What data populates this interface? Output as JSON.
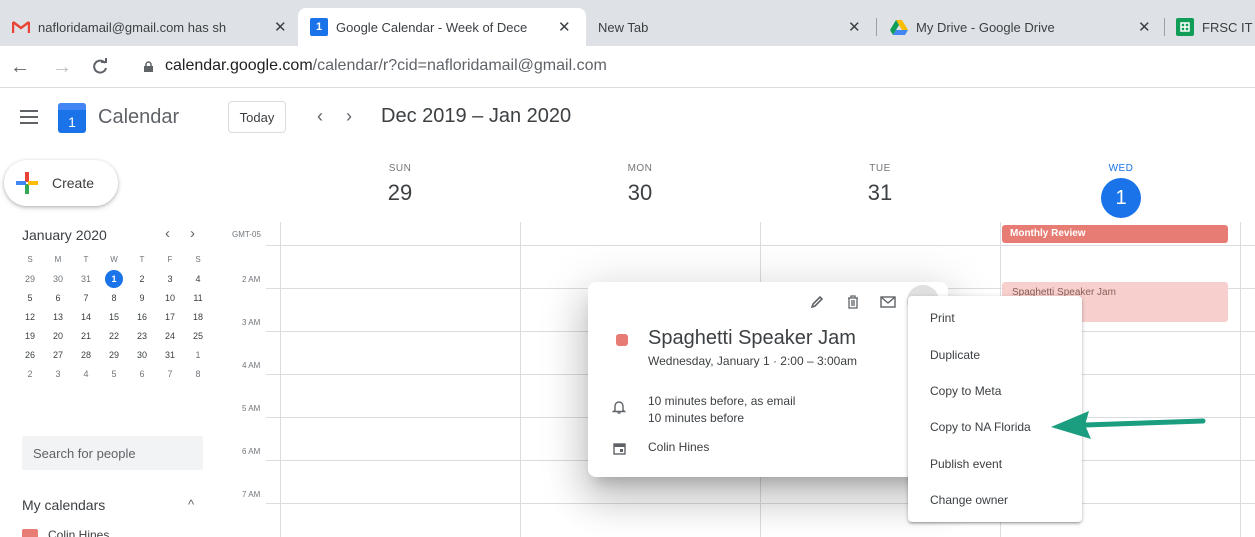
{
  "browser": {
    "tabs": [
      {
        "title": "nafloridamail@gmail.com has sh",
        "favicon": "gmail-icon"
      },
      {
        "title": "Google Calendar - Week of Dece",
        "favicon": "google-calendar-icon",
        "active": true
      },
      {
        "title": "New Tab",
        "favicon": ""
      },
      {
        "title": "My Drive - Google Drive",
        "favicon": "google-drive-icon"
      },
      {
        "title": "FRSC IT",
        "favicon": "google-sheets-icon"
      }
    ],
    "close_glyph": "✕",
    "url_host": "calendar.google.com",
    "url_path": "/calendar/r?cid=nafloridamail@gmail.com"
  },
  "header": {
    "app_title": "Calendar",
    "logo_day": "1",
    "today_label": "Today",
    "prev_glyph": "‹",
    "next_glyph": "›",
    "date_range": "Dec 2019 – Jan 2020"
  },
  "sidebar": {
    "create_label": "Create",
    "mini_calendar": {
      "title": "January 2020",
      "prev_glyph": "‹",
      "next_glyph": "›",
      "weekday_heads": [
        "S",
        "M",
        "T",
        "W",
        "T",
        "F",
        "S"
      ],
      "weeks": [
        [
          "29",
          "30",
          "31",
          "1",
          "2",
          "3",
          "4"
        ],
        [
          "5",
          "6",
          "7",
          "8",
          "9",
          "10",
          "11"
        ],
        [
          "12",
          "13",
          "14",
          "15",
          "16",
          "17",
          "18"
        ],
        [
          "19",
          "20",
          "21",
          "22",
          "23",
          "24",
          "25"
        ],
        [
          "26",
          "27",
          "28",
          "29",
          "30",
          "31",
          "1"
        ],
        [
          "2",
          "3",
          "4",
          "5",
          "6",
          "7",
          "8"
        ]
      ],
      "today": "1"
    },
    "search_placeholder": "Search for people",
    "my_calendars_title": "My calendars",
    "my_calendars_caret": "^",
    "calendars": [
      {
        "name": "Colin Hines",
        "color": "#e67c73"
      }
    ]
  },
  "week": {
    "days": [
      {
        "name": "SUN",
        "num": "29"
      },
      {
        "name": "MON",
        "num": "30"
      },
      {
        "name": "TUE",
        "num": "31"
      },
      {
        "name": "WED",
        "num": "1",
        "today": true
      }
    ],
    "timezone": "GMT-05",
    "hours": [
      "2 AM",
      "3 AM",
      "4 AM",
      "5 AM",
      "6 AM",
      "7 AM"
    ],
    "events": {
      "monthly_review": "Monthly Review",
      "spaghetti_chip": "Spaghetti Speaker Jam"
    }
  },
  "popover": {
    "title": "Spaghetti Speaker Jam",
    "when": "Wednesday, January 1  ·  2:00 – 3:00am",
    "notification_1": "10 minutes before, as email",
    "notification_2": "10 minutes before",
    "owner": "Colin Hines",
    "event_color": "#e67c73"
  },
  "menu": {
    "items": [
      "Print",
      "Duplicate",
      "Copy to Meta",
      "Copy to NA Florida",
      "Publish event",
      "Change owner"
    ]
  },
  "colors": {
    "accent": "#1a73e8",
    "event": "#e67c73",
    "annotation_arrow": "#1a9e7f"
  }
}
